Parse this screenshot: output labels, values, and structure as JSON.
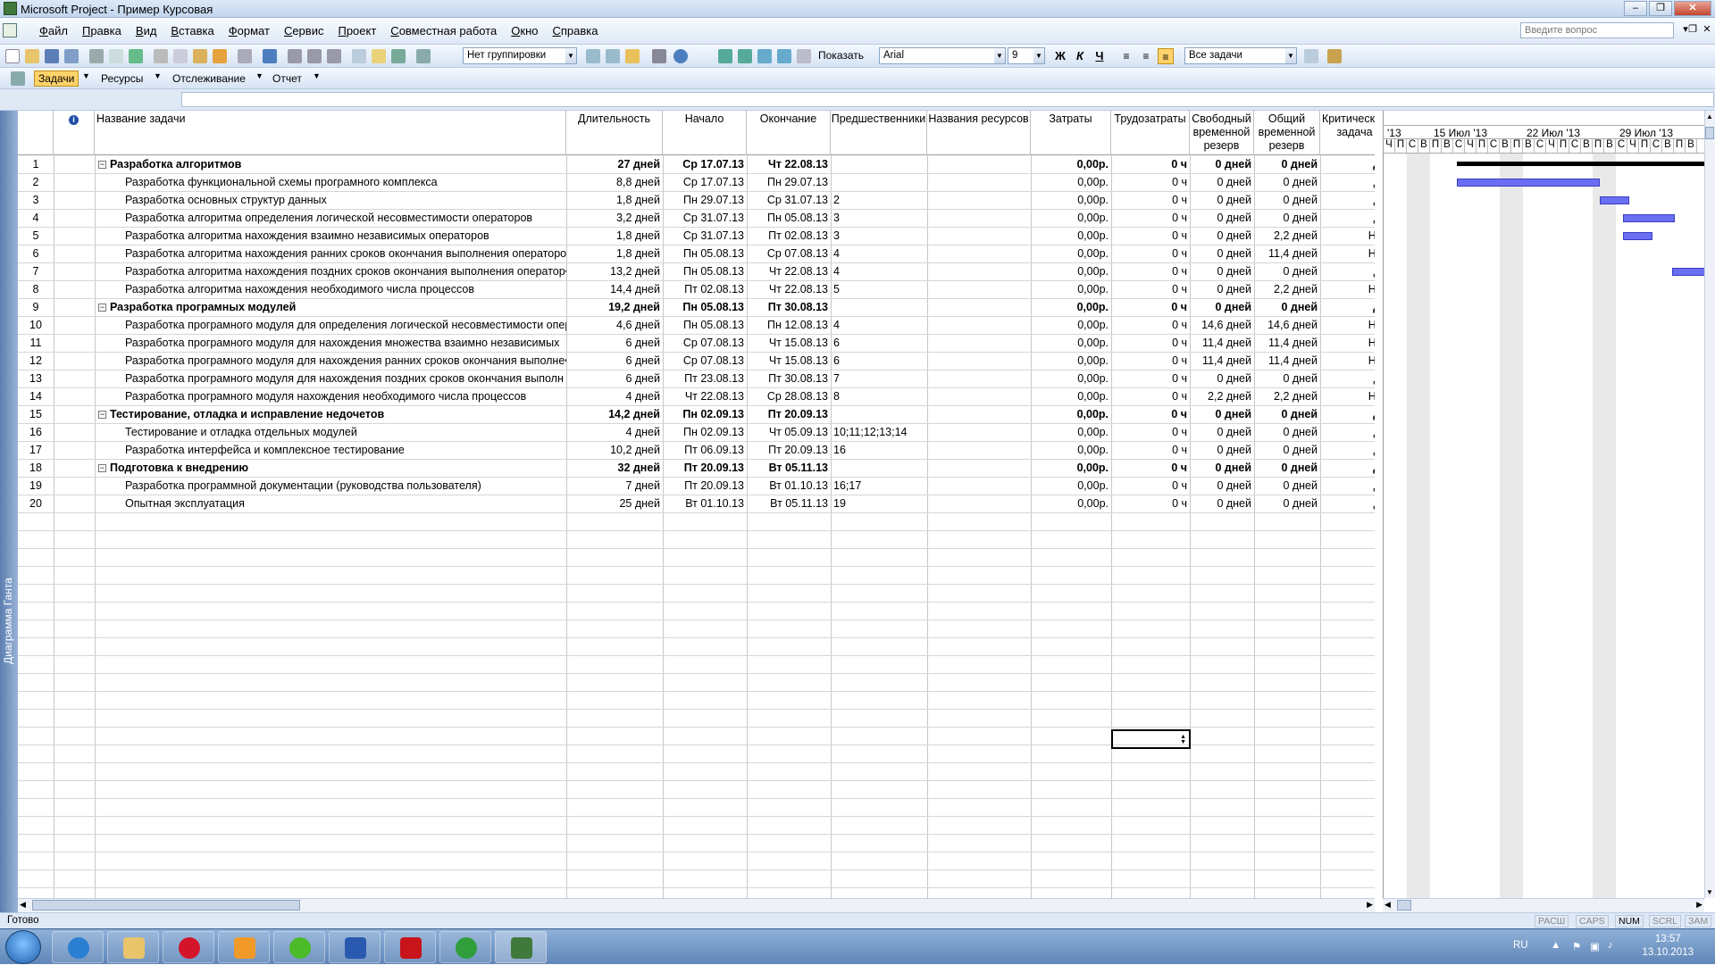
{
  "window": {
    "title": "Microsoft Project - Пример Курсовая"
  },
  "menu": {
    "items": [
      "Файл",
      "Правка",
      "Вид",
      "Вставка",
      "Формат",
      "Сервис",
      "Проект",
      "Совместная работа",
      "Окно",
      "Справка"
    ],
    "ask_placeholder": "Введите вопрос"
  },
  "toolbar": {
    "grouping": "Нет группировки",
    "show_label": "Показать",
    "font": "Arial",
    "font_size": "9",
    "bold": "Ж",
    "italic": "К",
    "underline": "Ч",
    "filter": "Все задачи"
  },
  "guide_toolbar": {
    "tasks": "Задачи",
    "resources": "Ресурсы",
    "tracking": "Отслеживание",
    "report": "Отчет"
  },
  "view_bar": {
    "label": "Диаграмма Ганта"
  },
  "columns": {
    "name": "Название задачи",
    "duration": "Длительность",
    "start": "Начало",
    "finish": "Окончание",
    "predecessors": "Предшественники",
    "resources": "Названия ресурсов",
    "cost": "Затраты",
    "work": "Трудозатраты",
    "free_slack": "Свободный временной резерв",
    "total_slack": "Общий временной резерв",
    "critical": "Критическая задача"
  },
  "tasks": [
    {
      "id": "1",
      "name": "Разработка алгоритмов",
      "duration": "27 дней",
      "start": "Ср 17.07.13",
      "finish": "Чт 22.08.13",
      "pred": "",
      "cost": "0,00р.",
      "work": "0 ч",
      "free": "0 дней",
      "total": "0 дней",
      "crit": "Да",
      "summary": true
    },
    {
      "id": "2",
      "name": "Разработка функциональной схемы програмного комплекса",
      "duration": "8,8 дней",
      "start": "Ср 17.07.13",
      "finish": "Пн 29.07.13",
      "pred": "",
      "cost": "0,00р.",
      "work": "0 ч",
      "free": "0 дней",
      "total": "0 дней",
      "crit": "Да"
    },
    {
      "id": "3",
      "name": "Разработка основных структур данных",
      "duration": "1,8 дней",
      "start": "Пн 29.07.13",
      "finish": "Ср 31.07.13",
      "pred": "2",
      "cost": "0,00р.",
      "work": "0 ч",
      "free": "0 дней",
      "total": "0 дней",
      "crit": "Да"
    },
    {
      "id": "4",
      "name": "Разработка алгоритма определения логической несовместимости операторов",
      "duration": "3,2 дней",
      "start": "Ср 31.07.13",
      "finish": "Пн 05.08.13",
      "pred": "3",
      "cost": "0,00р.",
      "work": "0 ч",
      "free": "0 дней",
      "total": "0 дней",
      "crit": "Да"
    },
    {
      "id": "5",
      "name": "Разработка алгоритма нахождения взаимно независимых операторов",
      "duration": "1,8 дней",
      "start": "Ср 31.07.13",
      "finish": "Пт 02.08.13",
      "pred": "3",
      "cost": "0,00р.",
      "work": "0 ч",
      "free": "0 дней",
      "total": "2,2 дней",
      "crit": "Нет"
    },
    {
      "id": "6",
      "name": "Разработка алгоритма нахождения ранних сроков окончания выполнения операторо",
      "duration": "1,8 дней",
      "start": "Пн 05.08.13",
      "finish": "Ср 07.08.13",
      "pred": "4",
      "cost": "0,00р.",
      "work": "0 ч",
      "free": "0 дней",
      "total": "11,4 дней",
      "crit": "Нет"
    },
    {
      "id": "7",
      "name": "Разработка алгоритма нахождения поздних сроков окончания выполнения оператор•",
      "duration": "13,2 дней",
      "start": "Пн 05.08.13",
      "finish": "Чт 22.08.13",
      "pred": "4",
      "cost": "0,00р.",
      "work": "0 ч",
      "free": "0 дней",
      "total": "0 дней",
      "crit": "Да"
    },
    {
      "id": "8",
      "name": "Разработка алгоритма нахождения необходимого числа процессов",
      "duration": "14,4 дней",
      "start": "Пт 02.08.13",
      "finish": "Чт 22.08.13",
      "pred": "5",
      "cost": "0,00р.",
      "work": "0 ч",
      "free": "0 дней",
      "total": "2,2 дней",
      "crit": "Нет"
    },
    {
      "id": "9",
      "name": "Разработка програмных модулей",
      "duration": "19,2 дней",
      "start": "Пн 05.08.13",
      "finish": "Пт 30.08.13",
      "pred": "",
      "cost": "0,00р.",
      "work": "0 ч",
      "free": "0 дней",
      "total": "0 дней",
      "crit": "Да",
      "summary": true
    },
    {
      "id": "10",
      "name": "Разработка програмного модуля для определения логической несовместимости опер",
      "duration": "4,6 дней",
      "start": "Пн 05.08.13",
      "finish": "Пн 12.08.13",
      "pred": "4",
      "cost": "0,00р.",
      "work": "0 ч",
      "free": "14,6 дней",
      "total": "14,6 дней",
      "crit": "Нет"
    },
    {
      "id": "11",
      "name": "Разработка програмного модуля для нахождения множества взаимно независимых",
      "duration": "6 дней",
      "start": "Ср 07.08.13",
      "finish": "Чт 15.08.13",
      "pred": "6",
      "cost": "0,00р.",
      "work": "0 ч",
      "free": "11,4 дней",
      "total": "11,4 дней",
      "crit": "Нет"
    },
    {
      "id": "12",
      "name": "Разработка програмного модуля для нахождения ранних сроков окончания выполне•",
      "duration": "6 дней",
      "start": "Ср 07.08.13",
      "finish": "Чт 15.08.13",
      "pred": "6",
      "cost": "0,00р.",
      "work": "0 ч",
      "free": "11,4 дней",
      "total": "11,4 дней",
      "crit": "Нет"
    },
    {
      "id": "13",
      "name": "Разработка програмного модуля для нахождения поздних сроков окончания выполн",
      "duration": "6 дней",
      "start": "Пт 23.08.13",
      "finish": "Пт 30.08.13",
      "pred": "7",
      "cost": "0,00р.",
      "work": "0 ч",
      "free": "0 дней",
      "total": "0 дней",
      "crit": "Да"
    },
    {
      "id": "14",
      "name": "Разработка програмного модуля нахождения необходимого числа процессов",
      "duration": "4 дней",
      "start": "Чт 22.08.13",
      "finish": "Ср 28.08.13",
      "pred": "8",
      "cost": "0,00р.",
      "work": "0 ч",
      "free": "2,2 дней",
      "total": "2,2 дней",
      "crit": "Нет"
    },
    {
      "id": "15",
      "name": "Тестирование, отладка и исправление недочетов",
      "duration": "14,2 дней",
      "start": "Пн 02.09.13",
      "finish": "Пт 20.09.13",
      "pred": "",
      "cost": "0,00р.",
      "work": "0 ч",
      "free": "0 дней",
      "total": "0 дней",
      "crit": "Да",
      "summary": true
    },
    {
      "id": "16",
      "name": "Тестирование и отладка отдельных модулей",
      "duration": "4 дней",
      "start": "Пн 02.09.13",
      "finish": "Чт 05.09.13",
      "pred": "10;11;12;13;14",
      "cost": "0,00р.",
      "work": "0 ч",
      "free": "0 дней",
      "total": "0 дней",
      "crit": "Да"
    },
    {
      "id": "17",
      "name": "Разработка интерфейса и комплексное тестирование",
      "duration": "10,2 дней",
      "start": "Пт 06.09.13",
      "finish": "Пт 20.09.13",
      "pred": "16",
      "cost": "0,00р.",
      "work": "0 ч",
      "free": "0 дней",
      "total": "0 дней",
      "crit": "Да"
    },
    {
      "id": "18",
      "name": "Подготовка к внедрению",
      "duration": "32 дней",
      "start": "Пт 20.09.13",
      "finish": "Вт 05.11.13",
      "pred": "",
      "cost": "0,00р.",
      "work": "0 ч",
      "free": "0 дней",
      "total": "0 дней",
      "crit": "Да",
      "summary": true
    },
    {
      "id": "19",
      "name": "Разработка программной документации (руководства пользователя)",
      "duration": "7 дней",
      "start": "Пт 20.09.13",
      "finish": "Вт 01.10.13",
      "pred": "16;17",
      "cost": "0,00р.",
      "work": "0 ч",
      "free": "0 дней",
      "total": "0 дней",
      "crit": "Да"
    },
    {
      "id": "20",
      "name": "Опытная эксплуатация",
      "duration": "25 дней",
      "start": "Вт 01.10.13",
      "finish": "Вт 05.11.13",
      "pred": "19",
      "cost": "0,00р.",
      "work": "0 ч",
      "free": "0 дней",
      "total": "0 дней",
      "crit": "Да"
    }
  ],
  "gantt": {
    "weeks": [
      "'13",
      "15 Июл '13",
      "22 Июл '13",
      "29 Июл '13"
    ],
    "days": [
      "Ч",
      "П",
      "С",
      "В",
      "П",
      "В",
      "С",
      "Ч",
      "П",
      "С",
      "В",
      "П",
      "В",
      "С",
      "Ч",
      "П",
      "С",
      "В",
      "П",
      "В",
      "С",
      "Ч",
      "П",
      "С",
      "В",
      "П",
      "В"
    ]
  },
  "status": {
    "text": "Готово",
    "indicators": [
      "РАСШ",
      "CAPS",
      "NUM",
      "SCRL",
      "ЗАМ"
    ],
    "active": "NUM"
  },
  "taskbar": {
    "lang": "RU",
    "time": "13:57",
    "date": "13.10.2013"
  }
}
